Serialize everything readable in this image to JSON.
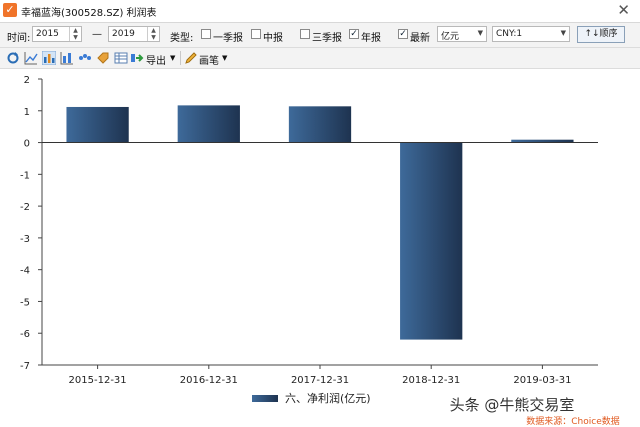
{
  "window": {
    "title": "幸福蓝海(300528.SZ) 利润表",
    "close_glyph": "✕"
  },
  "filter": {
    "time_label": "时间:",
    "start_year": "2015",
    "dash": "—",
    "end_year": "2019",
    "type_label": "类型:",
    "types": [
      {
        "label": "一季报",
        "checked": false
      },
      {
        "label": "中报",
        "checked": false
      },
      {
        "label": "三季报",
        "checked": false
      },
      {
        "label": "年报",
        "checked": true
      },
      {
        "label": "最新",
        "checked": true
      }
    ],
    "unit_value": "亿元",
    "currency_value": "CNY:1",
    "order_button": "↑↓顺序"
  },
  "toolbar": {
    "icons": [
      "refresh-icon",
      "line-chart-icon",
      "bar-chart-icon",
      "stacked-bar-icon",
      "scatter-icon",
      "tag-icon",
      "table-icon",
      "export-icon"
    ],
    "export_label": "导出",
    "pen_label": "画笔"
  },
  "chart_data": {
    "type": "bar",
    "categories": [
      "2015-12-31",
      "2016-12-31",
      "2017-12-31",
      "2018-12-31",
      "2019-03-31"
    ],
    "series": [
      {
        "name": "六、净利润(亿元)",
        "values": [
          1.12,
          1.17,
          1.14,
          -6.2,
          0.09
        ]
      }
    ],
    "ylim": [
      -7,
      2
    ],
    "yticks": [
      2,
      1,
      0,
      -1,
      -2,
      -3,
      -4,
      -5,
      -6,
      -7
    ],
    "legend_position": "bottom",
    "bar_color_dark": "#1e3350",
    "bar_color_light": "#3e6a9a"
  },
  "watermark": {
    "main": "头条 @牛熊交易室",
    "sub": "数据来源：Choice数据"
  }
}
